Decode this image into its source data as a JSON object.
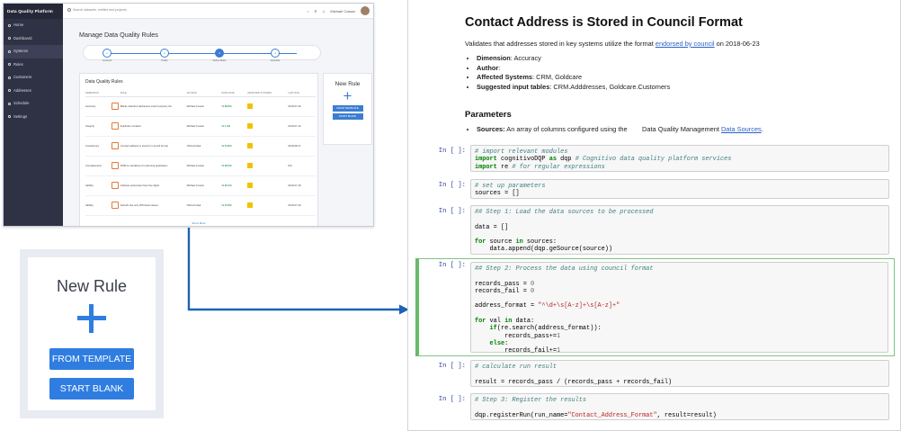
{
  "app": {
    "brand": "Data Quality Platform",
    "search_placeholder": "Search datasets, entities and projects",
    "user_name": "Michael Cossar",
    "nav": [
      "Home",
      "Dashboard",
      "Systems",
      "Rules",
      "Customers",
      "Addresses",
      "Schedule",
      "Settings"
    ],
    "page_title": "Manage Data Quality Rules",
    "steps": [
      {
        "num": "1",
        "label": "Contents"
      },
      {
        "num": "2",
        "label": "Profile"
      },
      {
        "num": "3",
        "label": "Define Rules"
      },
      {
        "num": "4",
        "label": "Schedule"
      }
    ],
    "rules_title": "Data Quality Rules",
    "table_headers": [
      "DIMENSION",
      "RULE",
      "",
      "AUTHOR",
      "PASS RATE",
      "AFFECTED SYSTEMS",
      "LAST RUN"
    ],
    "rows": [
      {
        "dimension": "Accuracy",
        "rule": "Blank collection addresses match property list",
        "author": "Michael Cossar",
        "pass": "% 99.8%",
        "last_run": "2019-07-20"
      },
      {
        "dimension": "Integrity",
        "rule": "Duplicate contacts",
        "author": "Michael Cossar",
        "pass": "% 1.4%",
        "last_run": "2019-07-12"
      },
      {
        "dimension": "Consistency",
        "rule": "Contact address is stored in council format",
        "author": "Olivia Kubek",
        "pass": "% 54.8%",
        "last_run": "2019-08-17"
      },
      {
        "dimension": "Completeness",
        "rule": "DOB is mandatory for planning application",
        "author": "Michael Cossar",
        "pass": "% 98.5%",
        "last_run": "N/A"
      },
      {
        "dimension": "Validity",
        "rule": "Address postcodes have five digits",
        "author": "Michael Cossar",
        "pass": "% 92.4%",
        "last_run": "2019-07-18"
      },
      {
        "dimension": "Validity",
        "rule": "Suburb has only 3M linked values",
        "author": "Olivia Kubek",
        "pass": "% 15.8%",
        "last_run": "2019-07-20"
      }
    ],
    "show_more": "Show More",
    "new_rule": {
      "title": "New Rule",
      "from_template": "FROM TEMPLATE",
      "start_blank": "START BLANK"
    }
  },
  "zoom_card": {
    "title": "New Rule",
    "plus": "+",
    "from_template": "FROM TEMPLATE",
    "start_blank": "START BLANK"
  },
  "notebook": {
    "title": "Contact Address is Stored in Council Format",
    "desc_before": "Validates that addresses stored in key systems utilize the format ",
    "desc_link": "endorsed by council",
    "desc_after": " on 2018-06-23",
    "bullets": [
      {
        "key": "Dimension",
        "val": ": Accuracy"
      },
      {
        "key": "Author",
        "val": ":"
      },
      {
        "key": "Affected Systems",
        "val": ": CRM, Goldcare"
      },
      {
        "key": "Suggested input tables",
        "val": ": CRM.Adddresses, Goldcare.Customers"
      }
    ],
    "params_title": "Parameters",
    "param_key": "Sources:",
    "param_text": " An array of columns configured using the        Data Quality Management ",
    "param_link": "Data Sources",
    "param_end": ".",
    "prompt": "In [ ]:"
  }
}
